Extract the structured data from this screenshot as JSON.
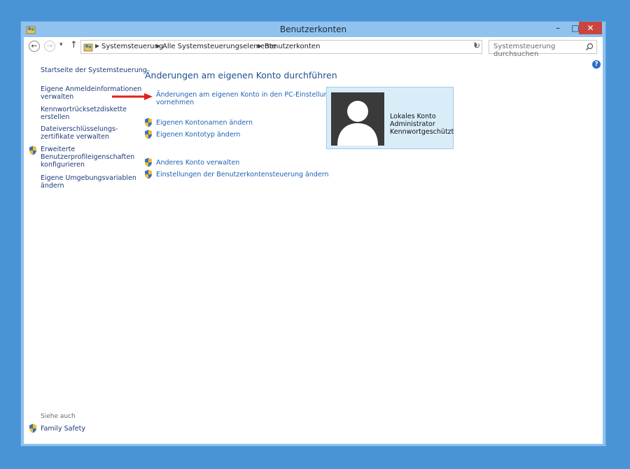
{
  "window": {
    "title": "Benutzerkonten"
  },
  "titlebar": {
    "minimize": "–",
    "maximize": "□",
    "close": "✕"
  },
  "address": {
    "crumbs": [
      "Systemsteuerung",
      "Alle Systemsteuerungselemente",
      "Benutzerkonten"
    ]
  },
  "search": {
    "placeholder": "Systemsteuerung durchsuchen"
  },
  "sidebar": {
    "home": "Startseite der Systemsteuerung",
    "items": [
      {
        "line1": "Eigene Anmeldeinformationen",
        "line2": "verwalten"
      },
      {
        "line1": "Kennwortrücksetzdiskette",
        "line2": "erstellen"
      },
      {
        "line1": "Dateiverschlüsselungs-",
        "line2": "zertifikate verwalten"
      },
      {
        "line1": "Erweiterte",
        "line2": "Benutzerprofileigenschaften",
        "line3": "konfigurieren"
      },
      {
        "line1": "Eigene Umgebungsvariablen",
        "line2": "ändern"
      }
    ],
    "see_also": "Siehe auch",
    "family_safety": "Family Safety"
  },
  "main": {
    "heading": "Änderungen am eigenen Konto durchführen",
    "pc_settings": {
      "line1": "Änderungen am eigenen Konto in den PC-Einstellungen",
      "line2": "vornehmen"
    },
    "tasks": [
      "Eigenen Kontonamen ändern",
      "Eigenen Kontotyp ändern",
      "Anderes Konto verwalten",
      "Einstellungen der Benutzerkontensteuerung ändern"
    ]
  },
  "account": {
    "type": "Lokales Konto",
    "role": "Administrator",
    "status": "Kennwortgeschützt"
  },
  "icons": [
    "app-icon",
    "back-arrow-icon",
    "forward-arrow-icon",
    "up-arrow-icon",
    "refresh-icon",
    "search-icon",
    "uac-shield-icon",
    "help-icon",
    "red-arrow-icon",
    "user-avatar-icon"
  ],
  "colors": {
    "desktop": "#4a93d6",
    "titlebar": "#8fc2ef",
    "close": "#c9453e",
    "link": "#1e63b5",
    "heading": "#1e4f8e",
    "card": "#d9edf9",
    "arrow": "#e0201b"
  }
}
